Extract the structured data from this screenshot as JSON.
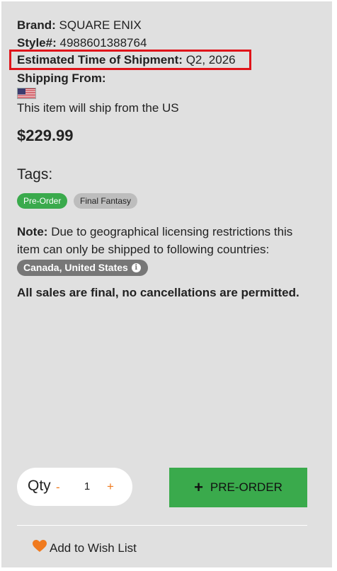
{
  "product": {
    "brand_label": "Brand:",
    "brand_value": "SQUARE ENIX",
    "style_label": "Style#:",
    "style_value": "4988601388764",
    "eta_label": "Estimated Time of Shipment:",
    "eta_value": "Q2, 2026",
    "shipping_label": "Shipping From:",
    "shipping_flag": "us-flag-icon",
    "shipping_text": "This item will ship from the US",
    "price": "$229.99"
  },
  "tags": {
    "title": "Tags:",
    "items": [
      "Pre-Order",
      "Final Fantasy"
    ]
  },
  "note": {
    "label": "Note:",
    "text": "Due to geographical licensing restrictions this item can only be shipped to following countries:",
    "countries": "Canada, United States",
    "info_icon": "info-icon"
  },
  "final_text": "All sales are final, no cancellations are permitted.",
  "qty": {
    "label": "Qty",
    "minus": "-",
    "value": "1",
    "plus": "+"
  },
  "preorder_button": {
    "icon": "+",
    "label": "PRE-ORDER"
  },
  "wishlist": {
    "icon": "heart-icon",
    "label": "Add to Wish List"
  },
  "colors": {
    "panel_bg": "#e0e0e0",
    "accent_green": "#3aaa4c",
    "accent_orange": "#f07a1e",
    "highlight_red": "#e0141a"
  }
}
